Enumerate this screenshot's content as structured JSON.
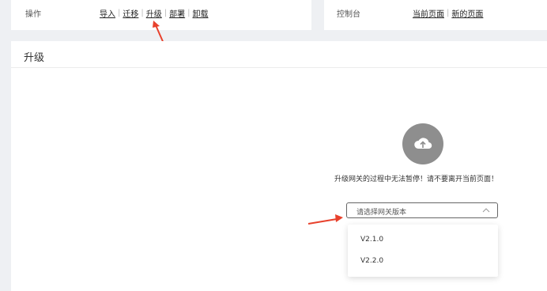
{
  "ops": {
    "label": "操作",
    "links": [
      "导入",
      "迁移",
      "升级",
      "部署",
      "卸载"
    ]
  },
  "console": {
    "label": "控制台",
    "links": [
      "当前页面",
      "新的页面"
    ]
  },
  "main": {
    "title": "升级",
    "icon": "cloud-upload-icon",
    "warning": "升级网关的过程中无法暂停！请不要离开当前页面！",
    "select": {
      "placeholder": "请选择网关版本"
    },
    "options": [
      "V2.1.0",
      "V2.2.0"
    ]
  },
  "colors": {
    "arrow": "#e8412c",
    "icon_bg": "#8e8e8e"
  }
}
